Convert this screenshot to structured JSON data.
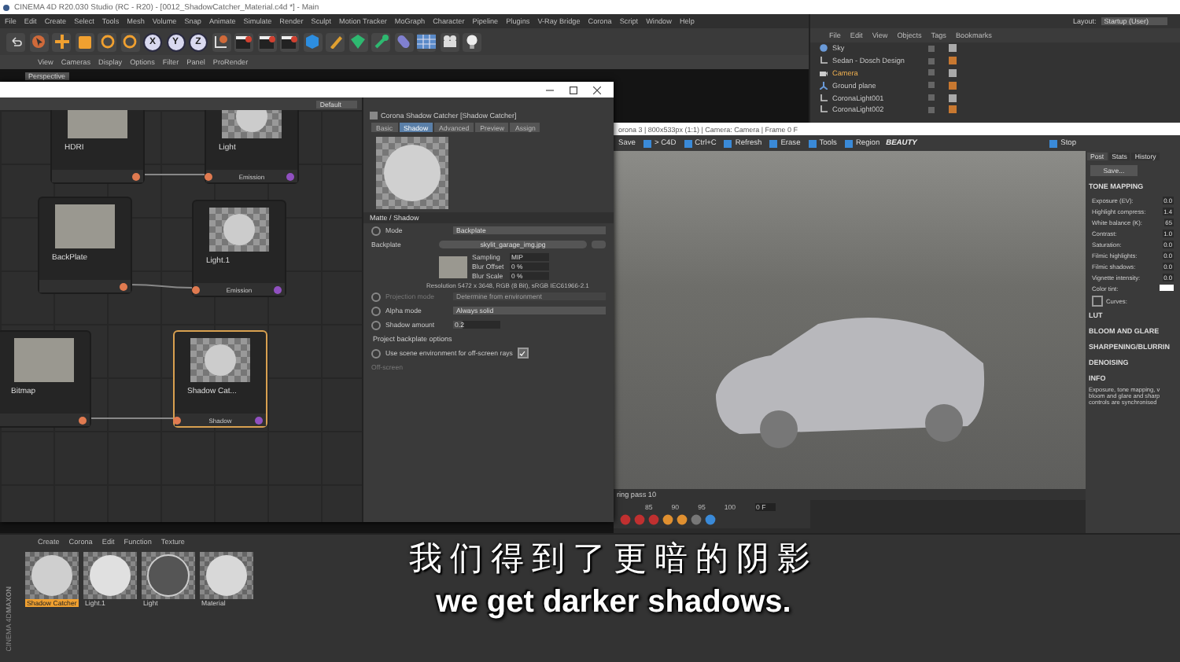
{
  "app_title": "CINEMA 4D R20.030 Studio (RC - R20) - [0012_ShadowCatcher_Material.c4d *] - Main",
  "menu": [
    "File",
    "Edit",
    "Create",
    "Select",
    "Tools",
    "Mesh",
    "Volume",
    "Snap",
    "Animate",
    "Simulate",
    "Render",
    "Sculpt",
    "Motion Tracker",
    "MoGraph",
    "Character",
    "Pipeline",
    "Plugins",
    "V-Ray Bridge",
    "Corona",
    "Script",
    "Window",
    "Help"
  ],
  "layout": {
    "label": "Layout:",
    "value": "Startup (User)"
  },
  "toolbar": [
    {
      "kind": "undo"
    },
    {
      "kind": "cursor"
    },
    {
      "kind": "move"
    },
    {
      "kind": "scale"
    },
    {
      "kind": "rotate"
    },
    {
      "kind": "rotate"
    },
    {
      "kind": "axis",
      "label": "X"
    },
    {
      "kind": "axis",
      "label": "Y"
    },
    {
      "kind": "axis",
      "label": "Z"
    },
    {
      "kind": "coord"
    },
    {
      "kind": "clapper"
    },
    {
      "kind": "clapper"
    },
    {
      "kind": "clapper"
    },
    {
      "kind": "cube"
    },
    {
      "kind": "pen"
    },
    {
      "kind": "gem"
    },
    {
      "kind": "spline"
    },
    {
      "kind": "capsule"
    },
    {
      "kind": "floor"
    },
    {
      "kind": "camera"
    },
    {
      "kind": "bulb"
    }
  ],
  "viewport": {
    "menu": [
      "View",
      "Cameras",
      "Display",
      "Options",
      "Filter",
      "Panel",
      "ProRender"
    ],
    "camera_label": "Perspective"
  },
  "object_manager": {
    "menu": [
      "File",
      "Edit",
      "View",
      "Objects",
      "Tags",
      "Bookmarks"
    ],
    "objects": [
      {
        "name": "Sky",
        "kind": "sky",
        "selected": false
      },
      {
        "name": "Sedan - Dosch Design",
        "kind": "null",
        "selected": false
      },
      {
        "name": "Camera",
        "kind": "camera",
        "selected": true
      },
      {
        "name": "Ground plane",
        "kind": "plane",
        "selected": false
      },
      {
        "name": "CoronaLight001",
        "kind": "null",
        "selected": false
      },
      {
        "name": "CoronaLight002",
        "kind": "null",
        "selected": false
      }
    ]
  },
  "node_editor": {
    "preset": "Default",
    "nodes": [
      {
        "title": "HDRI",
        "selected": false,
        "kind": "image"
      },
      {
        "title": "Light",
        "port": "Emission",
        "selected": false,
        "kind": "material"
      },
      {
        "title": "BackPlate",
        "selected": false,
        "kind": "image"
      },
      {
        "title": "Light.1",
        "port": "Emission",
        "selected": false,
        "kind": "material"
      },
      {
        "title": "Bitmap",
        "selected": false,
        "kind": "image"
      },
      {
        "title": "Shadow Cat...",
        "port": "Shadow",
        "selected": true,
        "kind": "material"
      }
    ]
  },
  "attributes": {
    "title": "Corona Shadow Catcher [Shadow Catcher]",
    "tabs": [
      {
        "label": "Basic",
        "selected": false
      },
      {
        "label": "Shadow",
        "selected": true
      },
      {
        "label": "Advanced",
        "selected": false
      },
      {
        "label": "Preview",
        "selected": false
      },
      {
        "label": "Assign",
        "selected": false
      }
    ],
    "section": "Matte / Shadow",
    "rows": [
      {
        "kind": "dropdown",
        "label": "Mode",
        "value": "Backplate",
        "disabled": false
      },
      {
        "kind": "file",
        "label": "Backplate",
        "value": "skylit_garage_img.jpg"
      },
      {
        "kind": "bitmap",
        "fields": [
          {
            "label": "Sampling",
            "value": "MIP"
          },
          {
            "label": "Blur Offset",
            "value": "0 %"
          },
          {
            "label": "Blur Scale",
            "value": "0 %"
          }
        ]
      },
      {
        "kind": "note",
        "value": "Resolution 5472 x 3648, RGB (8 Bit), sRGB IEC61966-2.1"
      },
      {
        "kind": "dropdown",
        "label": "Projection mode",
        "value": "Determine from environment",
        "disabled": true
      },
      {
        "kind": "dropdown",
        "label": "Alpha mode",
        "value": "Always solid",
        "disabled": false
      },
      {
        "kind": "number",
        "label": "Shadow amount",
        "value": "0.2",
        "level": 0.2
      },
      {
        "kind": "heading",
        "value": "Project backplate options"
      },
      {
        "kind": "checkbox",
        "label": "Use scene environment for off-screen rays",
        "checked": true
      },
      {
        "kind": "link",
        "label": "Off-screen",
        "disabled": true
      }
    ]
  },
  "render_window": {
    "title": "orona 3 | 800x533px (1:1) | Camera: Camera | Frame 0 F",
    "toolbar": [
      {
        "kind": "text",
        "label": "Save"
      },
      {
        "kind": "icon",
        "label": "> C4D"
      },
      {
        "kind": "icon",
        "label": "Ctrl+C"
      },
      {
        "kind": "icon",
        "label": "Refresh"
      },
      {
        "kind": "icon",
        "label": "Erase"
      },
      {
        "kind": "icon",
        "label": "Tools"
      },
      {
        "kind": "icon",
        "label": "Region"
      }
    ],
    "pass": "BEAUTY",
    "stop": "Stop",
    "status": "ring pass 10",
    "tabs": [
      {
        "label": "Post",
        "selected": true
      },
      {
        "label": "Stats",
        "selected": false
      },
      {
        "label": "History",
        "selected": false
      }
    ],
    "save": "Save...",
    "tone_mapping": "TONE MAPPING",
    "params": [
      {
        "label": "Exposure (EV):",
        "value": "0.0"
      },
      {
        "label": "Highlight compress:",
        "value": "1.4"
      },
      {
        "label": "White balance (K):",
        "value": "65"
      },
      {
        "label": "Contrast:",
        "value": "1.0"
      },
      {
        "label": "Saturation:",
        "value": "0.0"
      },
      {
        "label": "Filmic highlights:",
        "value": "0.0"
      },
      {
        "label": "Filmic shadows:",
        "value": "0.0"
      },
      {
        "label": "Vignette intensity:",
        "value": "0.0"
      }
    ],
    "color_tint": "Color tint:",
    "curves": {
      "label": "Curves:",
      "checked": false
    },
    "sections": [
      "LUT",
      "BLOOM AND GLARE",
      "SHARPENING/BLURRIN",
      "DENOISING"
    ],
    "info_title": "INFO",
    "info": "Exposure, tone mapping, v bloom and glare and sharp controls are synchronised",
    "timeline": {
      "ticks": [
        "85",
        "90",
        "95",
        "100"
      ],
      "frame": "0 F"
    }
  },
  "materials": {
    "menu": [
      "Create",
      "Corona",
      "Edit",
      "Function",
      "Texture"
    ],
    "items": [
      {
        "name": "Shadow Catcher",
        "kind": "catcher",
        "selected": true
      },
      {
        "name": "Light.1",
        "kind": "matte",
        "selected": false
      },
      {
        "name": "Light",
        "kind": "chrome",
        "selected": false
      },
      {
        "name": "Material",
        "kind": "plain",
        "selected": false
      }
    ]
  },
  "logo": {
    "brand": "MAXON",
    "product": "CINEMA 4D"
  },
  "subtitles": [
    "我们得到了更暗的阴影",
    "we get darker shadows."
  ]
}
